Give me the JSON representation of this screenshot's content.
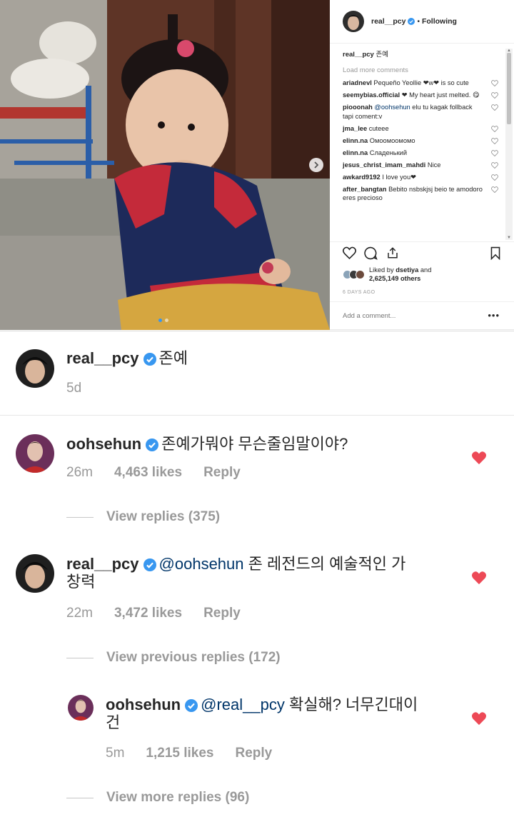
{
  "post": {
    "username": "real__pcy",
    "follow_status": "Following",
    "caption": "존예",
    "load_more": "Load more comments",
    "comments": [
      {
        "user": "ariadnevl",
        "text": "Pequeño Yeollie ❤w❤ is so cute"
      },
      {
        "user": "seemybias.official",
        "text": "❤ My heart just melted. 😋"
      },
      {
        "user": "piooonah",
        "mention": "@oohsehun",
        "text": "elu tu kagak follback tapi coment:v"
      },
      {
        "user": "jma_lee",
        "text": "cuteee"
      },
      {
        "user": "elinn.na",
        "text": "Омоомоомомо"
      },
      {
        "user": "elinn.na",
        "text": "Сладенький"
      },
      {
        "user": "jesus_christ_imam_mahdi",
        "text": "Nice"
      },
      {
        "user": "awkard9192",
        "text": "I love you❤"
      },
      {
        "user": "after_bangtan",
        "text": "Bebito nsbskjsj beio te amodoro eres precioso"
      }
    ],
    "liked_by_prefix": "Liked by",
    "liked_by_user": "dsetiya",
    "liked_by_suffix": "and",
    "liked_by_count": "2,625,149 others",
    "time_ago": "6 DAYS AGO",
    "add_comment_placeholder": "Add a comment...",
    "more_options": "•••",
    "carousel_total": 2,
    "carousel_active": 1
  },
  "mobile": {
    "caption": {
      "user": "real__pcy",
      "text": "존예",
      "time": "5d"
    },
    "comments": [
      {
        "user": "oohsehun",
        "text": "존예가뭐야 무슨줄임말이야?",
        "time": "26m",
        "likes": "4,463 likes",
        "reply": "Reply",
        "view_replies": "View replies (375)"
      },
      {
        "user": "real__pcy",
        "mention": "@oohsehun",
        "text_line1": "존 레전드의 예술적인 가",
        "text_line2": "창력",
        "time": "22m",
        "likes": "3,472 likes",
        "reply": "Reply",
        "view_replies": "View previous replies (172)"
      },
      {
        "user": "oohsehun",
        "mention": "@real__pcy",
        "text_line1": "확실해? 너무긴대이",
        "text_line2": "건",
        "time": "5m",
        "likes": "1,215 likes",
        "reply": "Reply",
        "view_replies": "View more replies (96)"
      }
    ]
  },
  "colors": {
    "verified_blue": "#3897f0",
    "heart_red": "#ed4956",
    "text_dark": "#262626",
    "text_muted": "#999999",
    "mention": "#003569"
  }
}
